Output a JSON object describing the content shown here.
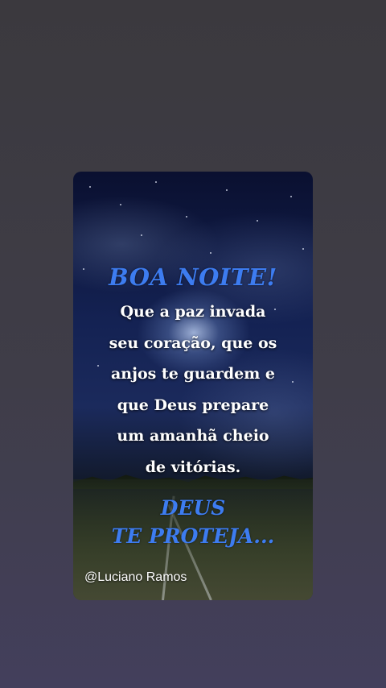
{
  "card": {
    "title": "BOA NOITE!",
    "message_lines": [
      "Que a paz invada",
      "seu coração, que os",
      "anjos te guardem e",
      "que Deus prepare",
      "um amanhã cheio",
      "de vitórias."
    ],
    "blessing_lines": [
      "DEUS",
      "TE PROTEJA..."
    ],
    "watermark": "@Luciano Ramos",
    "accent_color": "#3d7cf0"
  }
}
